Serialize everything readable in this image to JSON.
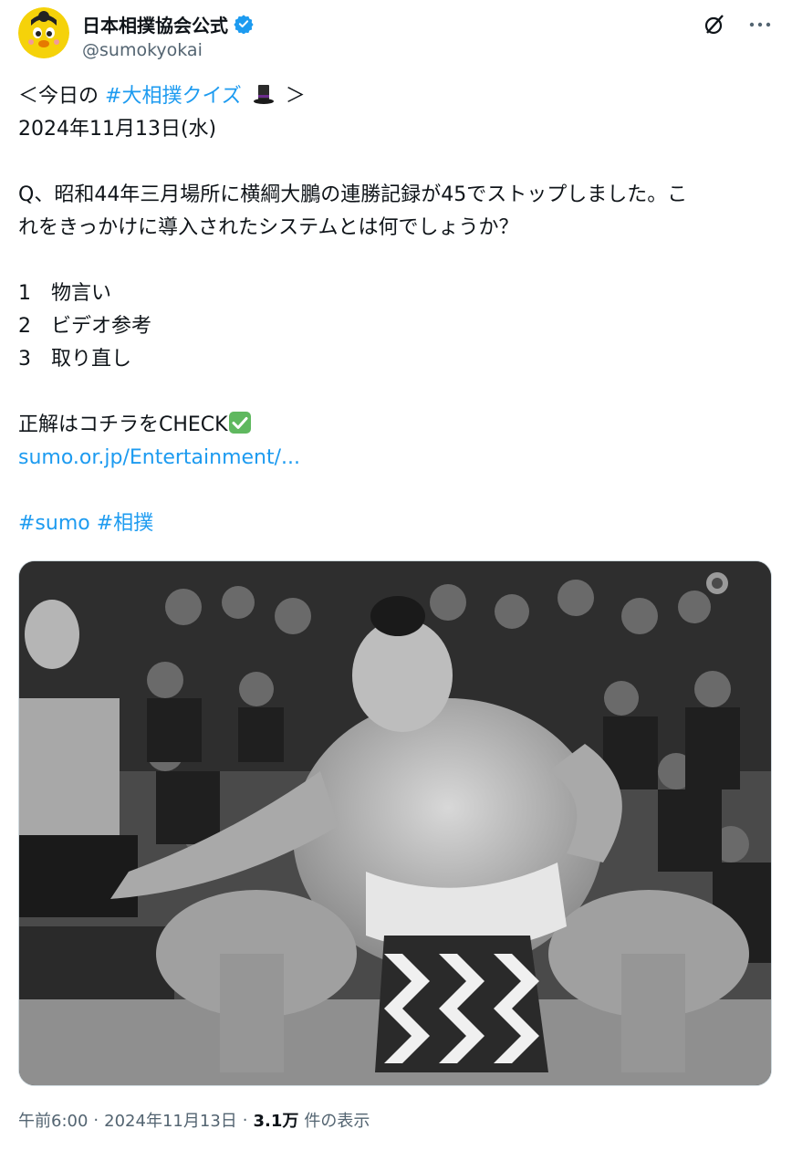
{
  "header": {
    "display_name": "日本相撲協会公式",
    "handle": "@sumokyokai",
    "verified_icon": "verified-badge-icon",
    "actions": [
      {
        "icon": "grok-icon"
      },
      {
        "icon": "more-icon",
        "label": "···"
      }
    ]
  },
  "tweet": {
    "line1_prefix": "＜今日の",
    "line1_hashtag": "#大相撲クイズ",
    "line1_suffix": "＞",
    "date_line": "2024年11月13日(水)",
    "question_line1": "Q、昭和44年三月場所に横綱大鵬の連勝記録が45でストップしました。こ",
    "question_line2": "れをきっかけに導入されたシステムとは何でしょうか？",
    "options": [
      {
        "num": "1",
        "text": "物言い"
      },
      {
        "num": "2",
        "text": "ビデオ参考"
      },
      {
        "num": "3",
        "text": "取り直し"
      }
    ],
    "answer_line": "正解はコチラをCHECK",
    "link_text": "sumo.or.jp/Entertainment/...",
    "hashtag1": "#sumo",
    "hashtag2": "#相撲"
  },
  "meta": {
    "time": "午前6:00",
    "sep1": "·",
    "date": "2024年11月13日",
    "sep2": "·",
    "views": "3.1万",
    "views_label": "件の表示"
  },
  "colors": {
    "link": "#1d9bf0",
    "text": "#0f1419",
    "muted": "#536471"
  }
}
